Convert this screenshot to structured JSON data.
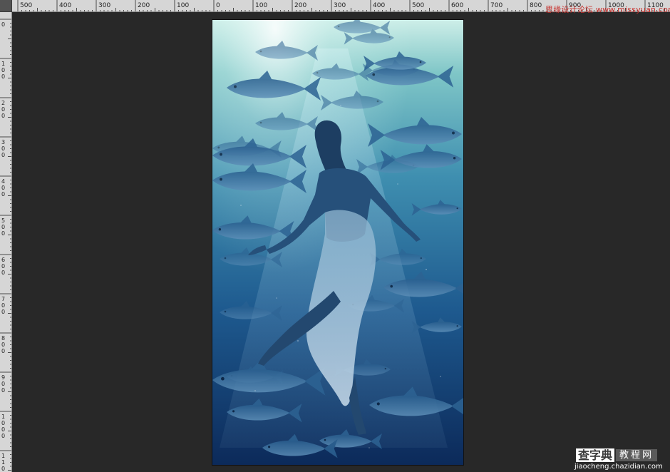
{
  "rulers": {
    "horizontal_labels": [
      "500",
      "400",
      "300",
      "200",
      "100",
      "0",
      "100",
      "200",
      "300",
      "400",
      "500",
      "600",
      "700",
      "800",
      "900",
      "1000",
      "1100"
    ],
    "vertical_labels": [
      "0",
      "100",
      "200",
      "300",
      "400",
      "500",
      "600",
      "700",
      "800",
      "900",
      "1000",
      "1100"
    ]
  },
  "document": {
    "image": "underwater-woman-swimming-with-tuna-school",
    "colors": {
      "light_top": "#bfe9e4",
      "mid_teal": "#3f8fa7",
      "deep_blue": "#0f2d5c",
      "darkest": "#0a1f45"
    }
  },
  "watermarks": {
    "top_right": "思缘设计论坛 www.missyuan.com",
    "brand": "查字典",
    "brand_box": "教程网",
    "url": "jiaocheng.chazidian.com"
  },
  "colors": {
    "workspace_bg": "#282828",
    "ruler_bg": "#d6d6d6",
    "watermark_red": "#c8302c"
  }
}
